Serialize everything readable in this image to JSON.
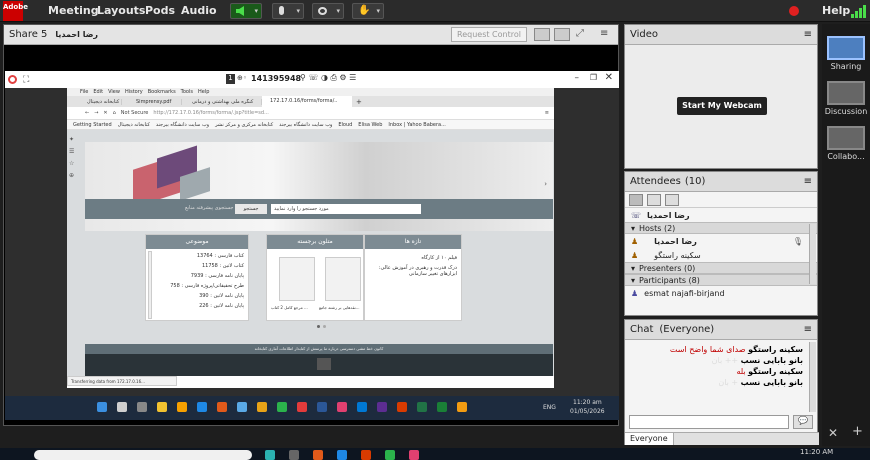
{
  "menubar": {
    "logo": "Adobe",
    "items": [
      "Meeting",
      "Layouts",
      "Pods",
      "Audio"
    ],
    "help": "Help"
  },
  "share_pod": {
    "title": "Share 5",
    "presenter": "رضا احمدیا",
    "request_control": "Request Control",
    "remote_id": "141395948"
  },
  "browser": {
    "menu": [
      "File",
      "Edit",
      "View",
      "History",
      "Bookmarks",
      "Tools",
      "Help"
    ],
    "tabs": [
      "کتابخانه دیجیتال",
      "Simprensy.pdf",
      "کنگره ملی بهداشتی و درمانی",
      "172.17.0.16/forms/forma/.."
    ],
    "not_secure": "Not Secure",
    "url": "http://172.17.0.16/forms/forma/.jsp?title=sd...",
    "bookmarks": [
      "Getting Started",
      "کتابخانه دیجیتال",
      "وب سایت دانشگاه بیرجند",
      "کتابخانه مرکزی و مرکز نشر",
      "وب سایت دانشگاه بیرجند",
      "Eloud",
      "Elisa Web",
      "Inbox | Yahoo Babera..."
    ],
    "search_label": "جستجوی پیشرفته منابع",
    "search_button": "جستجو",
    "search_placeholder": "مورد جستجو را وارد نمایید",
    "card_news": "تازه ها",
    "card_news_text": "فیلم ۱۰ از کارگاه",
    "card_news_text2": "درک قدرت و رهبری در آموزش عالی: ابزارهای تغییر سازمانی",
    "card_digital": "متلون برجسته",
    "card_digital_b1": "مرجع کامل 2 کتاب ...",
    "card_digital_b2": "نقدهایی بر رشته جامع...",
    "card_subject": "موضوعی",
    "subjects": [
      "کتاب فارسی : 13764",
      "کتاب لاتین : 11758",
      "پایان نامه فارسی : 7939",
      "طرح تحقیقاتی/پروژه فارسی : 758",
      "پایان نامه لاتین : 390",
      "پایان نامه لاتین : 226"
    ],
    "footer_links": "کانون  خط مشی دسترسی  درباره ما  پرسش از کتابدار  اطلاعات آماری کتابخانه",
    "status": "Transferring data from 172.17.0.16..."
  },
  "remote_taskbar": {
    "time": "11:20 am",
    "date": "01/05/2026",
    "lang": "ENG"
  },
  "video_pod": {
    "title": "Video",
    "webcam_button": "Start My Webcam"
  },
  "attendees_pod": {
    "title": "Attendees",
    "count": "(10)",
    "me": "رضا احمدیا",
    "hosts": "Hosts (2)",
    "host1": "رضا احمدیا",
    "host2": "سکینه راستگو",
    "presenters": "Presenters (0)",
    "participants": "Participants (8)",
    "participant1": "esmat najafi-birjand"
  },
  "chat_pod": {
    "title": "Chat",
    "scope": "(Everyone)",
    "messages": [
      {
        "author": "سکینه راستگو",
        "text": "صدای شما واضح است",
        "color": "#c00000"
      },
      {
        "author": "بانو بابایی نسب",
        "text": "++ بان",
        "color": "#000000"
      },
      {
        "author": "سکینه راستگو",
        "text": "بله",
        "color": "#c00000"
      },
      {
        "author": "بانو بابایی نسب",
        "text": "+ بان",
        "color": "#000000"
      }
    ],
    "tab": "Everyone"
  },
  "layouts": {
    "items": [
      "Sharing",
      "Discussion",
      "Collabo..."
    ]
  },
  "host_taskbar": {
    "time": "11:20 AM"
  }
}
